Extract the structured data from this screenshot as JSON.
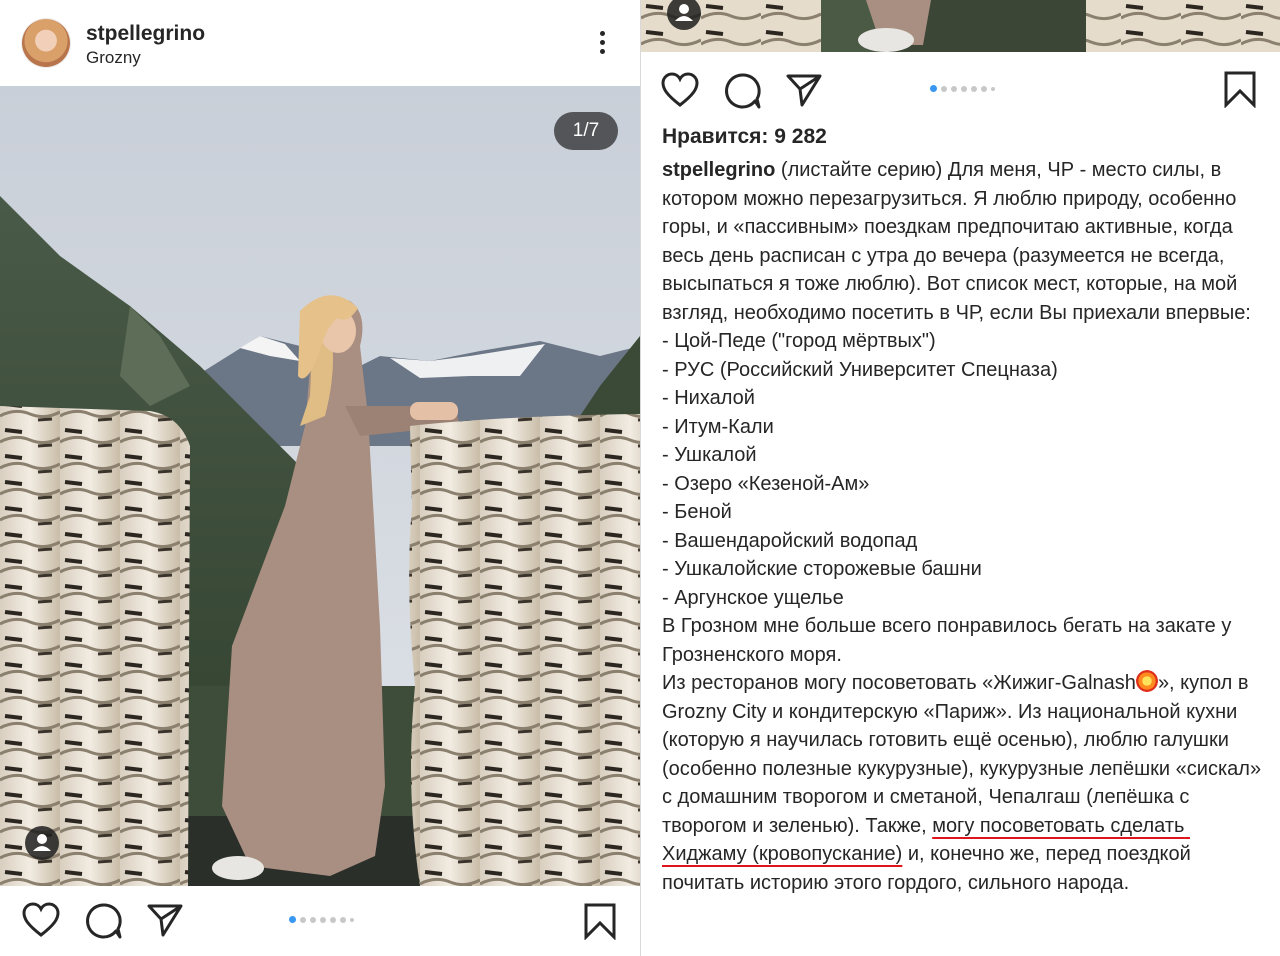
{
  "post": {
    "username": "stpellegrino",
    "location": "Grozny",
    "photo_counter": "1/7",
    "likes_label": "Нравится: 9 282",
    "carousel": {
      "total": 7,
      "active_index": 0
    }
  },
  "caption": {
    "username": "stpellegrino",
    "intro": " (листайте серию) Для меня, ЧР - место силы, в котором можно перезагрузиться. Я люблю природу, особенно горы, и «пассивным» поездкам предпочитаю активные, когда весь день расписан с утра до вечера (разумеется не всегда, высыпаться я тоже люблю). Вот список мест, которые, на мой взгляд, необходимо посетить в ЧР, если Вы приехали впервые: - Цой-Педе (\"город мёртвых\")",
    "list": [
      "- РУС (Российский Университет Спецназа)",
      "- Нихалой",
      "- Итум-Кали",
      "- Ушкалой",
      "- Озеро «Кезеной-Ам»",
      "- Беной",
      "- Вашендаройский водопад",
      "- Ушкалойские сторожевые башни",
      "- Аргунское ущелье"
    ],
    "grozny": "В Грозном мне больше всего понравилось бегать на закате у Грозненского моря.",
    "restaurants_a": "Из ресторанов могу посоветовать «Жижиг-Galnash",
    "restaurants_b": "», купол в Grozny City и кондитерскую «Париж». Из национальной кухни (которую я научилась готовить ещё осенью), люблю галушки (особенно полезные кукурузные), кукурузные лепёшки «сискал» с домашним творогом и сметаной, Чепалгаш (лепёшка с творогом и зеленью). Также, ",
    "highlight": "могу посоветовать сделать Хиджаму (кровопускание)",
    "ending": " и, конечно же, перед поездкой почитать историю этого гордого, сильного народа."
  },
  "icons": {
    "like": "heart-icon",
    "comment": "comment-icon",
    "share": "share-icon",
    "save": "bookmark-icon",
    "more": "more-icon",
    "tag": "user-tag-icon",
    "emoji": "collision-emoji"
  },
  "colors": {
    "text": "#262626",
    "active_dot": "#3897f0",
    "inactive_dot": "#c8c8c8",
    "highlight_underline": "#e0151b"
  }
}
